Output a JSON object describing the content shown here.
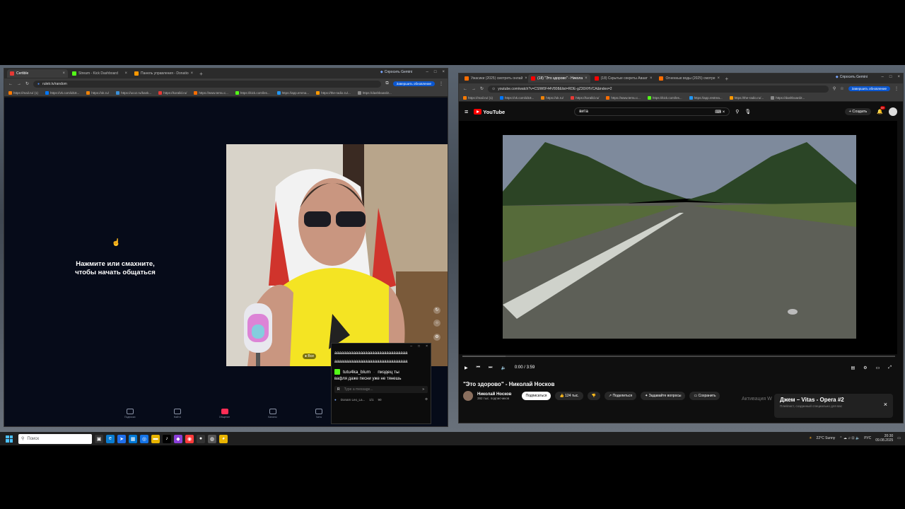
{
  "left_browser": {
    "tabs": [
      {
        "label": "Certible",
        "color": "#e53935",
        "active": true
      },
      {
        "label": "Stream - Kick Dashboard",
        "color": "#53fc18",
        "active": false
      },
      {
        "label": "Панель управления - Donatio",
        "color": "#ff9800",
        "active": false
      }
    ],
    "gemini": "Спросить Gemini",
    "address": "ruletr.tv/random",
    "update_button": "Завершить обновление",
    "bookmarks": [
      "https://mail.ru/ (1)",
      "https://vk.com/id18...",
      "https://ok.ru/",
      "https://ucoz.ru/bank...",
      "https://koralld.ru/",
      "https://www.temu.c...",
      "https://kick.com/les...",
      "https://app.emma...",
      "https://the-radio.ru/...",
      "https://dashboard2..."
    ]
  },
  "roulette": {
    "prompt_line1": "Нажмите или смахните,",
    "prompt_line2": "чтобы начать общаться",
    "cam_badge": "Все",
    "nav": [
      {
        "label": "Подписки",
        "active": false
      },
      {
        "label": "Найти",
        "active": false
      },
      {
        "label": "Общение",
        "active": true
      },
      {
        "label": "Каналы",
        "active": false
      },
      {
        "label": "Чаты",
        "active": false
      }
    ]
  },
  "chat": {
    "spam1": "ааааааааааааааааааааааааааааааа",
    "spam2": "ааааааааааааааааааааааааааааааа",
    "user": "tutu4ka_blum",
    "message_start": "пиздец ты",
    "message_rest": "вафля даже песни уже не тянешь",
    "input_placeholder": "Type a message...",
    "footer_name": "Donam Leo_La...",
    "footer_count1": "1/1",
    "footer_count2": "90"
  },
  "right_browser": {
    "tabs": [
      {
        "label": "Ужасики (2025) смотреть онлай",
        "color": "#ff6d00",
        "active": false
      },
      {
        "label": "(18) \"Это здорово\" - Никола",
        "color": "#ff0000",
        "active": true
      },
      {
        "label": "(18) Скрытые секреты Аваат",
        "color": "#ff0000",
        "active": false
      },
      {
        "label": "Огненные воды (2025) смотре",
        "color": "#ff6d00",
        "active": false
      }
    ],
    "gemini": "Спросить Gemini",
    "address": "youtube.com/watch?v=CSlW0F44V808&list=RDE-gZ30XHVCA&index=2",
    "update_button": "Завершить обновление",
    "bookmarks": [
      "https://mail.ru/ (1)",
      "https://vk.com/id18...",
      "https://ok.ru/",
      "https://koralld.ru/",
      "https://www.temu.c...",
      "https://kick.com/les...",
      "https://app.restrea...",
      "https://the-radio.ru/...",
      "https://dashboard2..."
    ]
  },
  "youtube": {
    "logo": "YouTube",
    "search_value": "вита",
    "create": "Создать",
    "notif_count": "9+",
    "time": "0:00 / 3:59",
    "title": "\"Это здорово\" - Николай Носков",
    "channel": "Николай Носков",
    "subscribers": "392 тыс. подписчиков",
    "subscribe": "Подписаться",
    "likes": "124 тыс.",
    "share": "Поделиться",
    "ask": "Задавайте вопросы",
    "save": "Сохранить",
    "watermark": "Активация W",
    "mini_title": "Джем – Vitas - Opera #2",
    "mini_sub": "Плейлист, созданный специально для вас"
  },
  "taskbar": {
    "search": "Поиск",
    "weather": "22°C  Sunny",
    "lang": "РУС",
    "time": "20:30",
    "date": "09.08.2025"
  }
}
